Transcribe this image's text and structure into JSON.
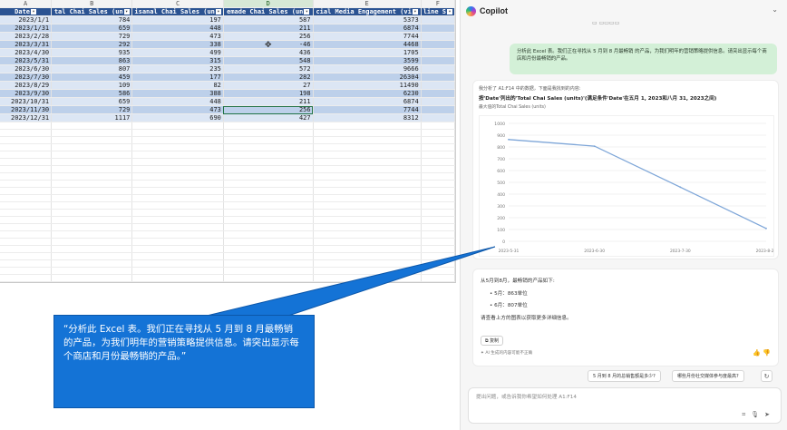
{
  "excel": {
    "column_letters": [
      "A",
      "B",
      "C",
      "D",
      "E",
      "F"
    ],
    "headers": [
      "Date",
      "tal Chai Sales (un",
      "isanal Chai Sales (un",
      "emade Chai Sales (un",
      "cial Media Engagement (vi",
      "line S"
    ],
    "rows": [
      [
        "2023/1/1",
        "784",
        "197",
        "587",
        "5373"
      ],
      [
        "2023/1/31",
        "659",
        "448",
        "211",
        "6874"
      ],
      [
        "2023/2/28",
        "729",
        "473",
        "256",
        "7744"
      ],
      [
        "2023/3/31",
        "292",
        "338",
        "-46",
        "4468"
      ],
      [
        "2023/4/30",
        "935",
        "499",
        "436",
        "1705"
      ],
      [
        "2023/5/31",
        "863",
        "315",
        "548",
        "3599"
      ],
      [
        "2023/6/30",
        "807",
        "235",
        "572",
        "9666"
      ],
      [
        "2023/7/30",
        "459",
        "177",
        "282",
        "26304"
      ],
      [
        "2023/8/29",
        "109",
        "82",
        "27",
        "11490"
      ],
      [
        "2023/9/30",
        "586",
        "388",
        "198",
        "6230"
      ],
      [
        "2023/10/31",
        "659",
        "448",
        "211",
        "6874"
      ],
      [
        "2023/11/30",
        "729",
        "473",
        "256",
        "7744"
      ],
      [
        "2023/12/31",
        "1117",
        "690",
        "427",
        "8312"
      ]
    ]
  },
  "copilot": {
    "title": "Copilot",
    "user_message": "分析此 Excel 表。我们正在寻找从 5 月到 8 月最畅销 的产品，为我们明年的营销策略提供信息。请突出显示每个商店和月份最畅销的产品。",
    "result_note": "我分析了 A1:F14 中的数据，下面是我找到的内容:",
    "result_title": "按'Date'列出的'Total Chai Sales (units)'(满足条件'Date'在五月 1, 2023和八月 31, 2023之间)",
    "result_subtitle": "最大值的Total Chai Sales (units)",
    "summary_intro": "从5月到8月，最畅销的产品如下:",
    "summary_items": [
      "5月：863单位",
      "6月：807单位"
    ],
    "summary_more": "请查看上方的图表以获取更多详细信息。",
    "copy_label": "复制",
    "ai_note": "AI 生成的内容可能不正确",
    "suggestions": [
      "5 月到 8 月的总销售额是多少?",
      "哪些月份社交媒体参与度最高?"
    ],
    "input_placeholder": "提出问题，或告诉我你希望如何处理 A1:F14"
  },
  "callout": {
    "text": "“分析此 Excel 表。我们正在寻找从 5 月到 8 月最畅销 的产品，为我们明年的营销策略提供信息。请突出显示每个商店和月份最畅销的产品。”"
  },
  "chart_data": {
    "type": "line",
    "title": "",
    "x": [
      "2023-5-31",
      "2023-6-30",
      "2023-7-30",
      "2023-8-29"
    ],
    "series": [
      {
        "values": [
          863,
          807,
          459,
          109
        ]
      }
    ],
    "ylim": [
      0,
      1000
    ],
    "yticks": [
      0,
      100,
      200,
      300,
      400,
      500,
      600,
      700,
      800,
      900,
      1000
    ],
    "grid": true,
    "color": "#7ea6d8"
  }
}
